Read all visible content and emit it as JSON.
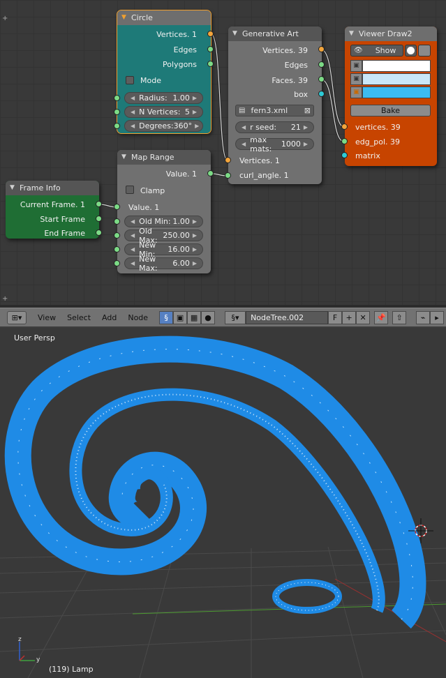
{
  "nodes": {
    "circle": {
      "title": "Circle",
      "outputs": [
        "Vertices. 1",
        "Edges",
        "Polygons"
      ],
      "mode_label": "Mode",
      "fields": [
        {
          "label": "Radius:",
          "value": "1.00"
        },
        {
          "label": "N Vertices:",
          "value": "5"
        },
        {
          "label": "Degrees:",
          "value": "360°"
        }
      ],
      "color": "#1e7a78"
    },
    "generative_art": {
      "title": "Generative Art",
      "outputs": [
        "Vertices. 39",
        "Edges",
        "Faces. 39",
        "box"
      ],
      "file": "fern3.xml",
      "fields": [
        {
          "label": "r seed:",
          "value": "21"
        },
        {
          "label": "max mats:",
          "value": "1000"
        }
      ],
      "inputs": [
        "Vertices. 1",
        "curl_angle. 1"
      ]
    },
    "viewer_draw": {
      "title": "Viewer Draw2",
      "show_label": "Show",
      "bake_label": "Bake",
      "inputs": [
        "vertices. 39",
        "edg_pol. 39",
        "matrix"
      ],
      "swatches": [
        "#ffffff",
        "#c9e7f8",
        "#3cbcf2"
      ],
      "color": "#c74400"
    },
    "map_range": {
      "title": "Map Range",
      "output": "Value. 1",
      "clamp_label": "Clamp",
      "input": "Value. 1",
      "fields": [
        {
          "label": "Old Min:",
          "value": "1.00"
        },
        {
          "label": "Old Max:",
          "value": "250.00"
        },
        {
          "label": "New Min:",
          "value": "16.00"
        },
        {
          "label": "New Max:",
          "value": "6.00"
        }
      ]
    },
    "frame_info": {
      "title": "Frame Info",
      "outputs": [
        "Current Frame. 1",
        "Start Frame",
        "End Frame"
      ],
      "color": "#1f6e34"
    }
  },
  "toolbar": {
    "menus": [
      "View",
      "Select",
      "Add",
      "Node"
    ],
    "tree_name": "NodeTree.002",
    "fake_user": "F"
  },
  "viewport": {
    "label": "User Persp",
    "status": "(119) Lamp",
    "mesh_color": "#1f8be6"
  }
}
